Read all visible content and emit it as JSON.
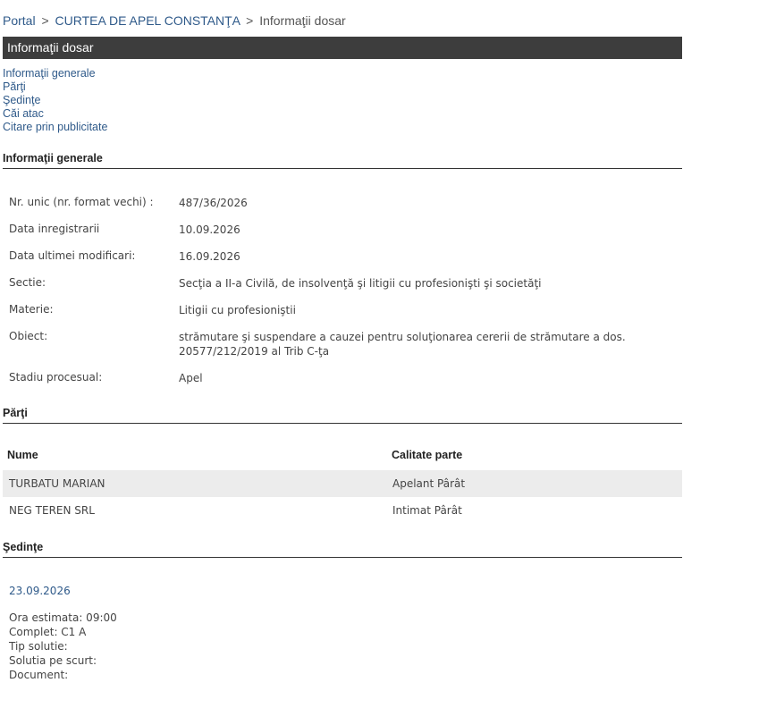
{
  "breadcrumb": {
    "portal": "Portal",
    "sep": ">",
    "court": "CURTEA DE APEL CONSTANŢA",
    "current": "Informaţii dosar"
  },
  "page_title": "Informaţii dosar",
  "nav": [
    "Informaţii generale",
    "Părţi",
    "Şedinţe",
    "Căi atac",
    "Citare prin publicitate"
  ],
  "general": {
    "heading": "Informaţii generale",
    "rows": [
      {
        "label": "Nr. unic (nr. format vechi) :",
        "value": "487/36/2026"
      },
      {
        "label": "Data inregistrarii",
        "value": "10.09.2026"
      },
      {
        "label": "Data ultimei modificari:",
        "value": "16.09.2026"
      },
      {
        "label": "Sectie:",
        "value": "Secţia a II-a Civilă, de insolvenţă şi litigii cu profesionişti şi societăţi"
      },
      {
        "label": "Materie:",
        "value": "Litigii cu profesioniştii"
      },
      {
        "label": "Obiect:",
        "value": "strămutare şi suspendare a cauzei pentru soluţionarea cererii de strămutare a dos. 20577/212/2019 al Trib C-ţa"
      },
      {
        "label": "Stadiu procesual:",
        "value": "Apel"
      }
    ]
  },
  "parti": {
    "heading": "Părţi",
    "columns": [
      "Nume",
      "Calitate parte"
    ],
    "rows": [
      [
        "TURBATU MARIAN",
        "Apelant Pârât"
      ],
      [
        "NEG TEREN SRL",
        "Intimat Pârât"
      ]
    ]
  },
  "sedinte": {
    "heading": "Şedinţe",
    "date": "23.09.2026",
    "details": [
      "Ora estimata: 09:00",
      "Complet: C1 A",
      "Tip solutie:",
      "Solutia pe scurt:",
      "Document:"
    ]
  }
}
